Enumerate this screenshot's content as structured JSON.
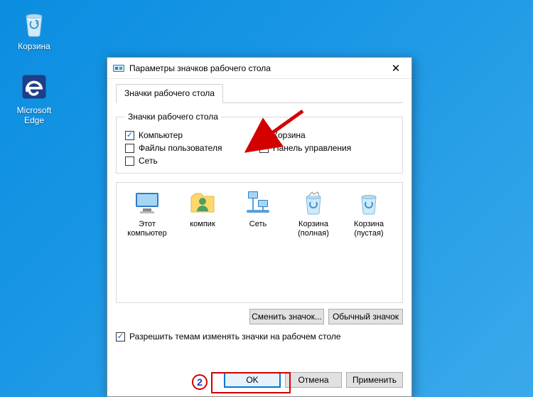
{
  "desktop": {
    "recycle_label": "Корзина",
    "edge_label": "Microsoft Edge"
  },
  "window": {
    "title": "Параметры значков рабочего стола",
    "tab": "Значки рабочего стола",
    "group_legend": "Значки рабочего стола",
    "checkboxes": {
      "computer": "Компьютер",
      "user_files": "Файлы пользователя",
      "network": "Сеть",
      "recycle": "Корзина",
      "control_panel": "Панель управления"
    },
    "checkbox_state": {
      "computer": true,
      "user_files": false,
      "network": false,
      "recycle": true,
      "control_panel": true
    },
    "icons": {
      "this_pc": "Этот компьютер",
      "user_folder": "компик",
      "network": "Сеть",
      "recycle_full": "Корзина (полная)",
      "recycle_empty": "Корзина (пустая)"
    },
    "buttons": {
      "change_icon": "Сменить значок...",
      "default_icon": "Обычный значок"
    },
    "allow_themes": "Разрешить темам изменять значки на рабочем столе",
    "allow_themes_checked": true,
    "footer": {
      "ok": "OK",
      "cancel": "Отмена",
      "apply": "Применить"
    }
  },
  "annotation": {
    "step": "2"
  }
}
